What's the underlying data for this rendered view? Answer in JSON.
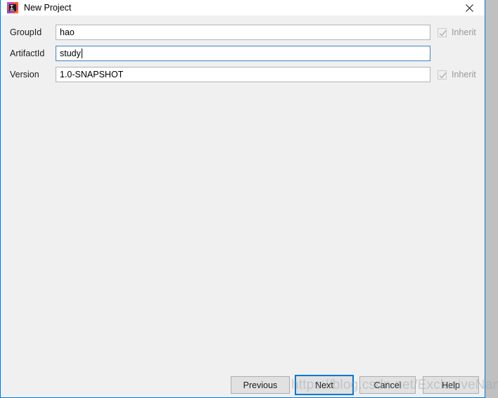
{
  "window": {
    "title": "New Project",
    "app_icon": "intellij-idea-icon",
    "close_icon": "close-icon",
    "accent_color": "#0078d7",
    "background_color": "#f0f0f0",
    "titlebar_color": "#ffffff"
  },
  "form": {
    "fields": [
      {
        "label": "GroupId",
        "value": "hao",
        "placeholder": "",
        "focused": false,
        "inherit": {
          "label": "Inherit",
          "checked": true,
          "disabled": true
        }
      },
      {
        "label": "ArtifactId",
        "value": "study",
        "placeholder": "",
        "focused": true,
        "inherit": null
      },
      {
        "label": "Version",
        "value": "1.0-SNAPSHOT",
        "placeholder": "",
        "focused": false,
        "inherit": {
          "label": "Inherit",
          "checked": true,
          "disabled": true
        }
      }
    ]
  },
  "footer": {
    "previous_label": "Previous",
    "next_label": "Next",
    "cancel_label": "Cancel",
    "help_label": "Help",
    "focused_button": "Next"
  },
  "watermark": {
    "text": "https://blog.csdn.net/ExclusiveName"
  }
}
